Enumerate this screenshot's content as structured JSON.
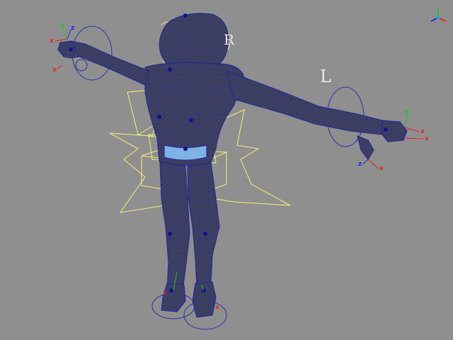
{
  "viewport": {
    "background_color": "#8f8f8f",
    "control_curve_color": "#f2f07a",
    "mesh_fill_color": "#3f4250",
    "wireframe_color": "#2c2fa8",
    "joint_color": "#10138f",
    "ring_color": "#2b2fae",
    "highlight_color": "#7fb2e5"
  },
  "controls": {
    "letter_left": "L",
    "letter_right": "R"
  },
  "axes": {
    "x": "x",
    "y": "y",
    "z": "z",
    "x_color": "#e52424",
    "y_color": "#1fc41f",
    "z_color": "#2424e5"
  },
  "view_cube": {
    "icon": "view-cube-icon"
  }
}
